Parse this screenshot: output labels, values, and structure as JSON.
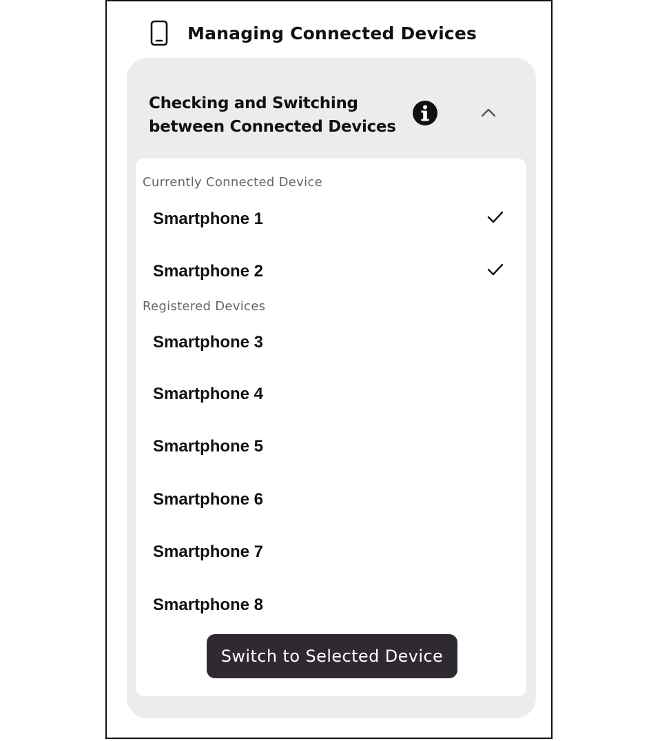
{
  "header": {
    "title": "Managing Connected Devices",
    "icon": "smartphone-icon"
  },
  "section": {
    "title_line1": "Checking and Switching",
    "title_line2": "between Connected Devices",
    "info_icon": "info-icon",
    "toggle_icon": "chevron-up-icon",
    "expanded": true
  },
  "connected": {
    "label": "Currently Connected Device",
    "devices": [
      {
        "name": "Smartphone 1",
        "checked": true
      },
      {
        "name": "Smartphone 2",
        "checked": true
      }
    ]
  },
  "registered": {
    "label": "Registered Devices",
    "devices": [
      {
        "name": "Smartphone 3"
      },
      {
        "name": "Smartphone 4"
      },
      {
        "name": "Smartphone 5"
      },
      {
        "name": "Smartphone 6"
      },
      {
        "name": "Smartphone 7"
      },
      {
        "name": "Smartphone 8"
      }
    ]
  },
  "actions": {
    "switch_label": "Switch to Selected Device"
  },
  "colors": {
    "panel_background": "#ecedeb",
    "button_background": "#2f2a31",
    "label_gray": "#666666"
  }
}
